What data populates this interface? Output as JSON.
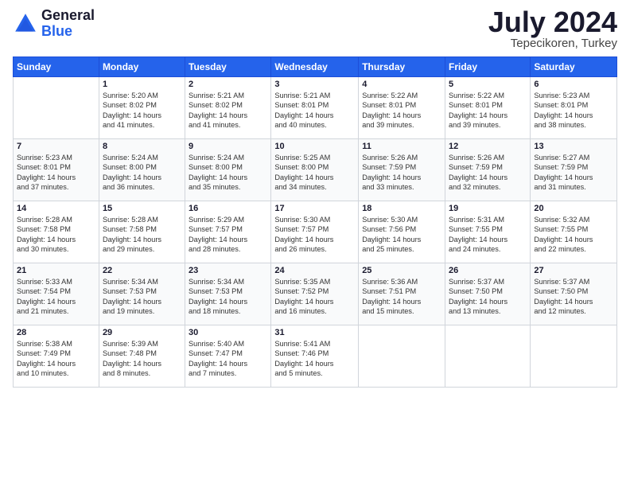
{
  "logo": {
    "general": "General",
    "blue": "Blue"
  },
  "header": {
    "month": "July 2024",
    "location": "Tepecikoren, Turkey"
  },
  "weekdays": [
    "Sunday",
    "Monday",
    "Tuesday",
    "Wednesday",
    "Thursday",
    "Friday",
    "Saturday"
  ],
  "weeks": [
    [
      {
        "day": "",
        "info": ""
      },
      {
        "day": "1",
        "info": "Sunrise: 5:20 AM\nSunset: 8:02 PM\nDaylight: 14 hours\nand 41 minutes."
      },
      {
        "day": "2",
        "info": "Sunrise: 5:21 AM\nSunset: 8:02 PM\nDaylight: 14 hours\nand 41 minutes."
      },
      {
        "day": "3",
        "info": "Sunrise: 5:21 AM\nSunset: 8:01 PM\nDaylight: 14 hours\nand 40 minutes."
      },
      {
        "day": "4",
        "info": "Sunrise: 5:22 AM\nSunset: 8:01 PM\nDaylight: 14 hours\nand 39 minutes."
      },
      {
        "day": "5",
        "info": "Sunrise: 5:22 AM\nSunset: 8:01 PM\nDaylight: 14 hours\nand 39 minutes."
      },
      {
        "day": "6",
        "info": "Sunrise: 5:23 AM\nSunset: 8:01 PM\nDaylight: 14 hours\nand 38 minutes."
      }
    ],
    [
      {
        "day": "7",
        "info": "Sunrise: 5:23 AM\nSunset: 8:01 PM\nDaylight: 14 hours\nand 37 minutes."
      },
      {
        "day": "8",
        "info": "Sunrise: 5:24 AM\nSunset: 8:00 PM\nDaylight: 14 hours\nand 36 minutes."
      },
      {
        "day": "9",
        "info": "Sunrise: 5:24 AM\nSunset: 8:00 PM\nDaylight: 14 hours\nand 35 minutes."
      },
      {
        "day": "10",
        "info": "Sunrise: 5:25 AM\nSunset: 8:00 PM\nDaylight: 14 hours\nand 34 minutes."
      },
      {
        "day": "11",
        "info": "Sunrise: 5:26 AM\nSunset: 7:59 PM\nDaylight: 14 hours\nand 33 minutes."
      },
      {
        "day": "12",
        "info": "Sunrise: 5:26 AM\nSunset: 7:59 PM\nDaylight: 14 hours\nand 32 minutes."
      },
      {
        "day": "13",
        "info": "Sunrise: 5:27 AM\nSunset: 7:59 PM\nDaylight: 14 hours\nand 31 minutes."
      }
    ],
    [
      {
        "day": "14",
        "info": "Sunrise: 5:28 AM\nSunset: 7:58 PM\nDaylight: 14 hours\nand 30 minutes."
      },
      {
        "day": "15",
        "info": "Sunrise: 5:28 AM\nSunset: 7:58 PM\nDaylight: 14 hours\nand 29 minutes."
      },
      {
        "day": "16",
        "info": "Sunrise: 5:29 AM\nSunset: 7:57 PM\nDaylight: 14 hours\nand 28 minutes."
      },
      {
        "day": "17",
        "info": "Sunrise: 5:30 AM\nSunset: 7:57 PM\nDaylight: 14 hours\nand 26 minutes."
      },
      {
        "day": "18",
        "info": "Sunrise: 5:30 AM\nSunset: 7:56 PM\nDaylight: 14 hours\nand 25 minutes."
      },
      {
        "day": "19",
        "info": "Sunrise: 5:31 AM\nSunset: 7:55 PM\nDaylight: 14 hours\nand 24 minutes."
      },
      {
        "day": "20",
        "info": "Sunrise: 5:32 AM\nSunset: 7:55 PM\nDaylight: 14 hours\nand 22 minutes."
      }
    ],
    [
      {
        "day": "21",
        "info": "Sunrise: 5:33 AM\nSunset: 7:54 PM\nDaylight: 14 hours\nand 21 minutes."
      },
      {
        "day": "22",
        "info": "Sunrise: 5:34 AM\nSunset: 7:53 PM\nDaylight: 14 hours\nand 19 minutes."
      },
      {
        "day": "23",
        "info": "Sunrise: 5:34 AM\nSunset: 7:53 PM\nDaylight: 14 hours\nand 18 minutes."
      },
      {
        "day": "24",
        "info": "Sunrise: 5:35 AM\nSunset: 7:52 PM\nDaylight: 14 hours\nand 16 minutes."
      },
      {
        "day": "25",
        "info": "Sunrise: 5:36 AM\nSunset: 7:51 PM\nDaylight: 14 hours\nand 15 minutes."
      },
      {
        "day": "26",
        "info": "Sunrise: 5:37 AM\nSunset: 7:50 PM\nDaylight: 14 hours\nand 13 minutes."
      },
      {
        "day": "27",
        "info": "Sunrise: 5:37 AM\nSunset: 7:50 PM\nDaylight: 14 hours\nand 12 minutes."
      }
    ],
    [
      {
        "day": "28",
        "info": "Sunrise: 5:38 AM\nSunset: 7:49 PM\nDaylight: 14 hours\nand 10 minutes."
      },
      {
        "day": "29",
        "info": "Sunrise: 5:39 AM\nSunset: 7:48 PM\nDaylight: 14 hours\nand 8 minutes."
      },
      {
        "day": "30",
        "info": "Sunrise: 5:40 AM\nSunset: 7:47 PM\nDaylight: 14 hours\nand 7 minutes."
      },
      {
        "day": "31",
        "info": "Sunrise: 5:41 AM\nSunset: 7:46 PM\nDaylight: 14 hours\nand 5 minutes."
      },
      {
        "day": "",
        "info": ""
      },
      {
        "day": "",
        "info": ""
      },
      {
        "day": "",
        "info": ""
      }
    ]
  ]
}
